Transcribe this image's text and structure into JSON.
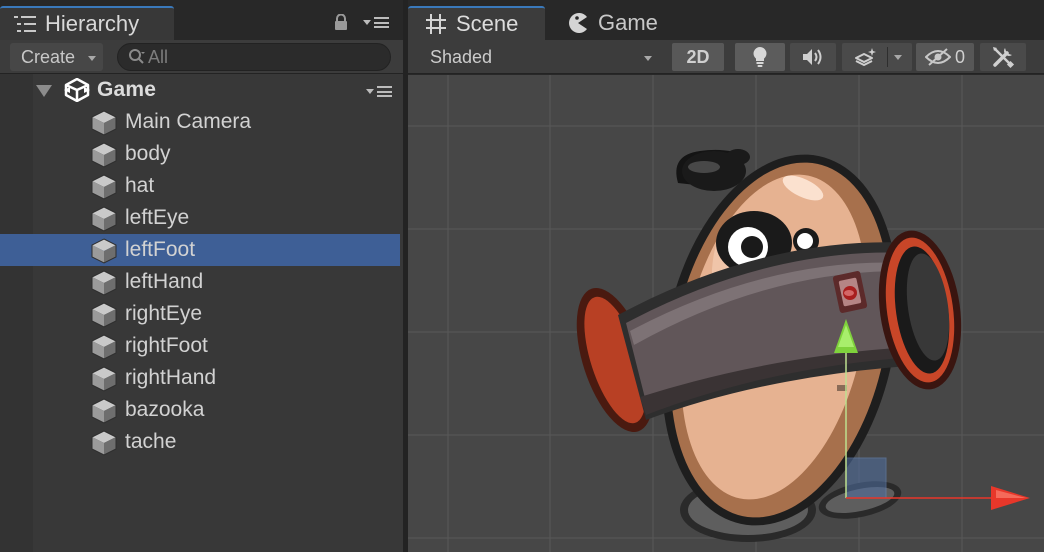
{
  "hierarchy": {
    "tab_label": "Hierarchy",
    "tab_icon": "list-icon",
    "create_label": "Create",
    "search_placeholder": "All",
    "scene_name": "Game",
    "objects": [
      {
        "name": "Main Camera",
        "selected": false
      },
      {
        "name": "body",
        "selected": false
      },
      {
        "name": "hat",
        "selected": false
      },
      {
        "name": "leftEye",
        "selected": false
      },
      {
        "name": "leftFoot",
        "selected": true
      },
      {
        "name": "leftHand",
        "selected": false
      },
      {
        "name": "rightEye",
        "selected": false
      },
      {
        "name": "rightFoot",
        "selected": false
      },
      {
        "name": "rightHand",
        "selected": false
      },
      {
        "name": "bazooka",
        "selected": false
      },
      {
        "name": "tache",
        "selected": false
      }
    ]
  },
  "scene_view": {
    "tabs": [
      {
        "label": "Scene",
        "icon": "grid-icon",
        "active": true
      },
      {
        "label": "Game",
        "icon": "pacman-icon",
        "active": false
      }
    ],
    "shading_mode": "Shaded",
    "mode_2d_label": "2D",
    "hidden_count": "0",
    "toolbar_icons": [
      "lightbulb-icon",
      "audio-icon",
      "effects-icon",
      "hidden-eye-icon",
      "gizmos-tools-icon"
    ],
    "gizmo": {
      "x_axis_color": "#e8372a",
      "y_axis_color": "#7fd23c",
      "rect_color": "#4f6fa3"
    }
  },
  "colors": {
    "selection": "#3e5f96",
    "panel_bg": "#383838",
    "tab_accent": "#3a79bb",
    "viewport_bg": "#474747"
  }
}
